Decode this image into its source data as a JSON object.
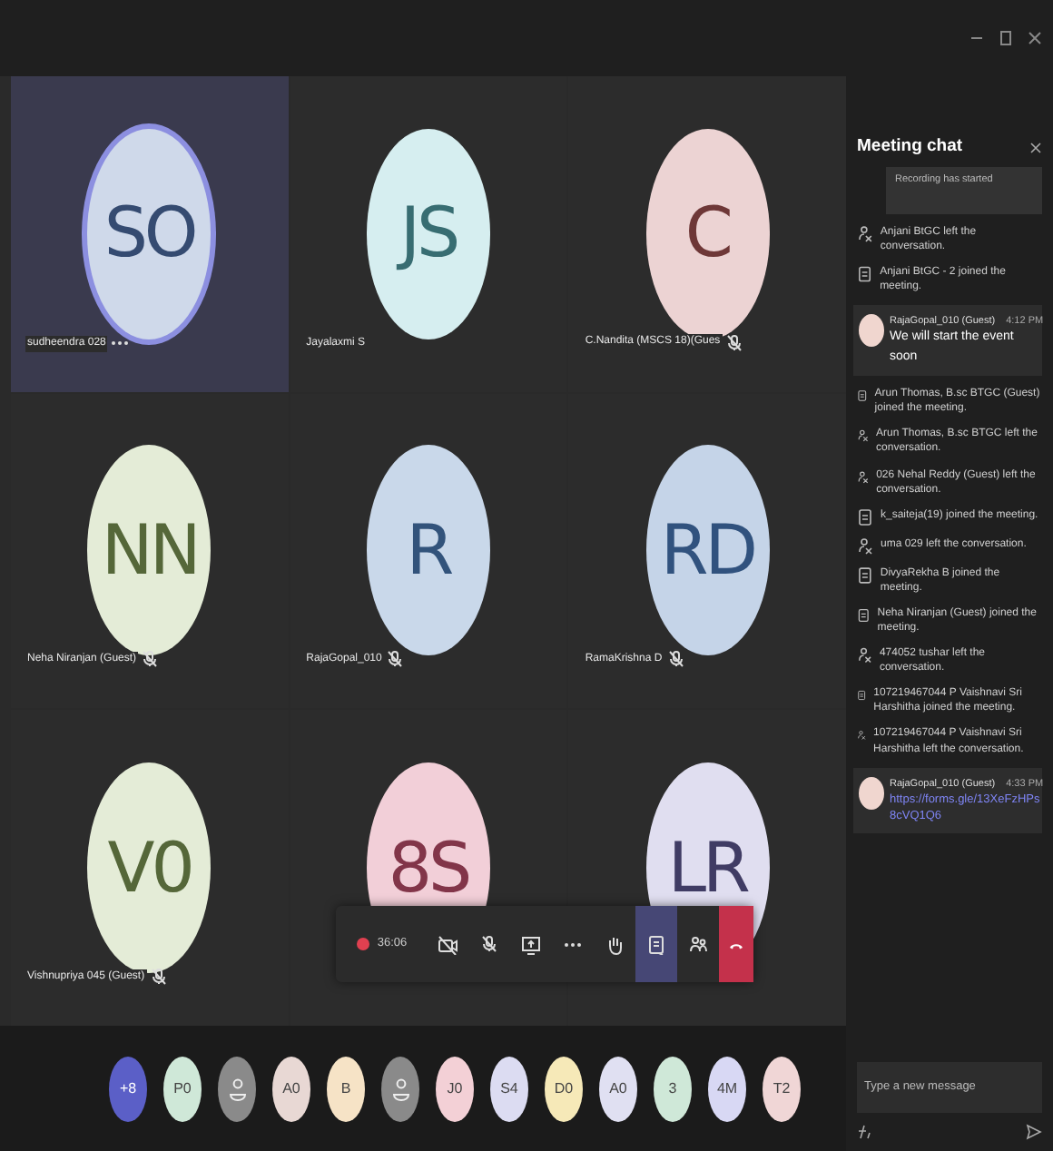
{
  "tiles": [
    {
      "initials": "SO",
      "name": "sudheendra 028",
      "muted": false,
      "menu": true,
      "speaking": true,
      "color": "#cfd9ea"
    },
    {
      "initials": "JS",
      "name": "Jayalaxmi S",
      "muted": false,
      "menu": false,
      "speaking": false,
      "color": "#d6eef0"
    },
    {
      "initials": "C",
      "name": "C.Nandita (MSCS 18)(Gues",
      "muted": true,
      "menu": false,
      "speaking": false,
      "color": "#ecd3d3"
    },
    {
      "initials": "NN",
      "name": "Neha Niranjan (Guest)",
      "muted": true,
      "menu": false,
      "speaking": false,
      "color": "#e4ecd7"
    },
    {
      "initials": "R",
      "name": "RajaGopal_010",
      "muted": true,
      "menu": false,
      "speaking": false,
      "color": "#c9d8ea"
    },
    {
      "initials": "RD",
      "name": "RamaKrishna D",
      "muted": true,
      "menu": false,
      "speaking": false,
      "color": "#c5d4e8"
    },
    {
      "initials": "V0",
      "name": "Vishnupriya 045 (Guest)",
      "muted": true,
      "menu": false,
      "speaking": false,
      "color": "#e4ecd7"
    },
    {
      "initials": "8S",
      "speaking": false,
      "color": "#f2cfd8"
    },
    {
      "initials": "LR",
      "speaking": false,
      "color": "#e0def0"
    }
  ],
  "toolbar": {
    "timer": "36:06",
    "recording": true,
    "chat_selected": true
  },
  "roster": [
    {
      "kind": "initials",
      "text": "+8",
      "color": "#5b5fc7"
    },
    {
      "kind": "initials",
      "text": "P0",
      "color": "#cfe8d8"
    },
    {
      "kind": "person",
      "color": "#8a8a8a"
    },
    {
      "kind": "initials",
      "text": "A0",
      "color": "#e8d8d4"
    },
    {
      "kind": "initials",
      "text": "B",
      "color": "#f6e3c6"
    },
    {
      "kind": "person",
      "color": "#8a8a8a"
    },
    {
      "kind": "initials",
      "text": "J0",
      "color": "#f3d0d6"
    },
    {
      "kind": "initials",
      "text": "S4",
      "color": "#dcdcf2"
    },
    {
      "kind": "initials",
      "text": "D0",
      "color": "#f6e9b8"
    },
    {
      "kind": "initials",
      "text": "A0",
      "color": "#e0e0f2"
    },
    {
      "kind": "initials",
      "text": "3",
      "color": "#cfe8d8"
    },
    {
      "kind": "initials",
      "text": "4M",
      "color": "#d8d8f4"
    },
    {
      "kind": "initials",
      "text": "T2",
      "color": "#f0d6d6"
    }
  ],
  "chat": {
    "title": "Meeting chat",
    "items": [
      {
        "kind": "notice",
        "text": "Recording has started"
      },
      {
        "kind": "leave",
        "text": "Anjani BtGC left the conversation."
      },
      {
        "kind": "join",
        "text": "Anjani BtGC - 2 joined the meeting."
      },
      {
        "kind": "message",
        "author": "RajaGopal_010 (Guest)",
        "time": "4:12 PM",
        "text": "We will start the event soon"
      },
      {
        "kind": "join",
        "text": "Arun Thomas, B.sc BTGC (Guest) joined the meeting."
      },
      {
        "kind": "leave",
        "text": "Arun Thomas, B.sc BTGC left the conversation."
      },
      {
        "kind": "leave",
        "text": "026 Nehal Reddy (Guest) left the conversation."
      },
      {
        "kind": "join",
        "text": "k_saiteja(19) joined the meeting."
      },
      {
        "kind": "leave",
        "text": "uma 029 left the conversation."
      },
      {
        "kind": "join",
        "text": "DivyaRekha B joined the meeting."
      },
      {
        "kind": "join",
        "text": "Neha Niranjan (Guest) joined the meeting."
      },
      {
        "kind": "leave",
        "text": "474052 tushar left the conversation."
      },
      {
        "kind": "join",
        "text": "107219467044 P Vaishnavi Sri Harshitha joined the meeting."
      },
      {
        "kind": "leave",
        "text": "107219467044 P Vaishnavi Sri Harshitha left the conversation."
      },
      {
        "kind": "message",
        "author": "RajaGopal_010 (Guest)",
        "time": "4:33 PM",
        "link": "https://forms.gle/13XeFzHPs8cVQ1Q6"
      }
    ],
    "input": {
      "placeholder": "Type a new message"
    }
  }
}
